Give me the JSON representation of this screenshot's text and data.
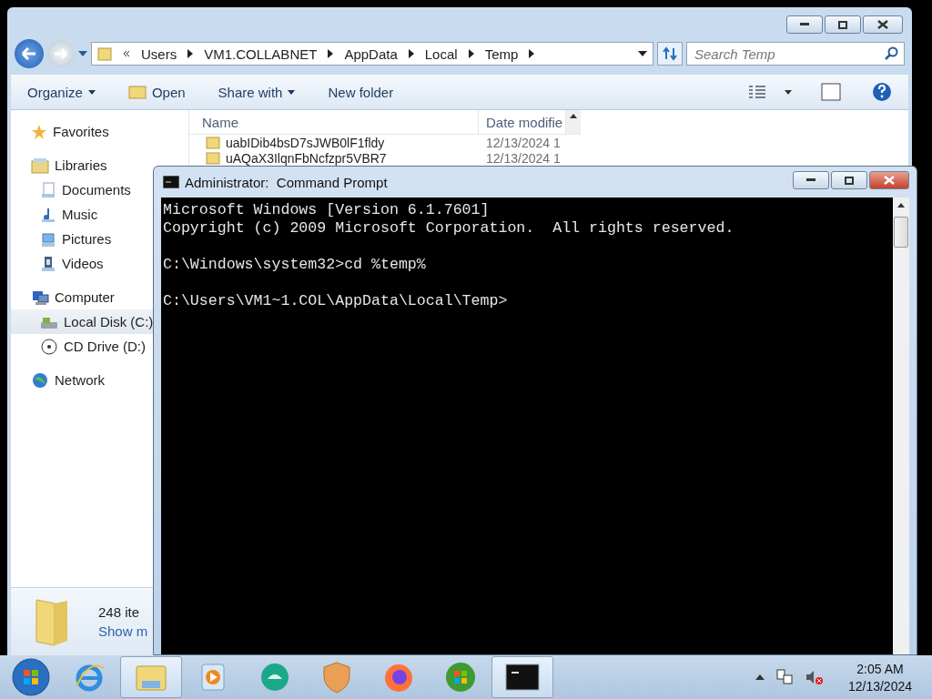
{
  "explorer": {
    "path": [
      "Users",
      "VM1.COLLABNET",
      "AppData",
      "Local",
      "Temp"
    ],
    "search": {
      "placeholder": "Search Temp"
    },
    "toolbar": [
      {
        "label": "Organize",
        "kind": "menu"
      },
      {
        "label": "Open",
        "kind": "open"
      },
      {
        "label": "Share with",
        "kind": "menu"
      },
      {
        "label": "New folder",
        "kind": "plain"
      }
    ],
    "sidebar": [
      {
        "label": "Favorites",
        "kind": "star",
        "selected": false
      },
      {
        "label": "Libraries",
        "kind": "library",
        "selected": false,
        "children": [
          {
            "label": "Documents",
            "kind": "document",
            "selected": false
          },
          {
            "label": "Music",
            "kind": "music",
            "selected": false
          },
          {
            "label": "Pictures",
            "kind": "pictures",
            "selected": false
          },
          {
            "label": "Videos",
            "kind": "videos",
            "selected": false
          }
        ]
      },
      {
        "label": "Computer",
        "kind": "computer",
        "selected": false,
        "children": [
          {
            "label": "Local Disk (C:)",
            "kind": "disk",
            "selected": true
          },
          {
            "label": "CD Drive (D:)",
            "kind": "cd",
            "selected": false
          }
        ]
      },
      {
        "label": "Network",
        "kind": "network",
        "selected": false
      }
    ],
    "columns": [
      "Name",
      "Date modifie"
    ],
    "files": [
      {
        "name": "uabIDib4bsD7sJWB0lF1fldy",
        "date": "12/13/2024 1"
      },
      {
        "name": "uAQaX3IlqnFbNcfzpr5VBR7",
        "date": "12/13/2024 1"
      }
    ],
    "details": {
      "count": "248 ite",
      "link": "Show m"
    }
  },
  "cmd": {
    "title": "Administrator:  Command Prompt",
    "blocks": [
      [
        "Microsoft Windows [Version 6.1.7601]",
        "Copyright (c) 2009 Microsoft Corporation.  All rights reserved."
      ],
      [
        "C:\\Windows\\system32>cd %temp%"
      ],
      [
        "C:\\Users\\VM1~1.COL\\AppData\\Local\\Temp>"
      ]
    ]
  },
  "taskbar": {
    "apps": [
      {
        "kind": "ie",
        "selected": false
      },
      {
        "kind": "explorer",
        "selected": true
      },
      {
        "kind": "player",
        "selected": false
      },
      {
        "kind": "chat",
        "selected": false
      },
      {
        "kind": "shield",
        "selected": false
      },
      {
        "kind": "firefox",
        "selected": false
      },
      {
        "kind": "orb",
        "selected": false
      },
      {
        "kind": "console",
        "selected": true
      }
    ],
    "time": "2:05 AM",
    "date": "12/13/2024"
  }
}
